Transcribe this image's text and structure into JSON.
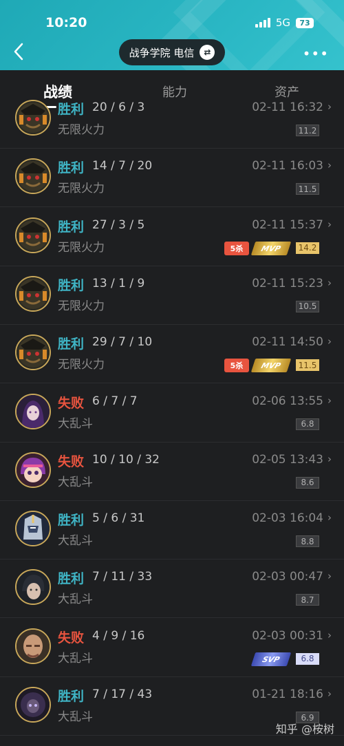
{
  "status_bar": {
    "time": "10:20",
    "network": "5G",
    "battery": "73"
  },
  "header": {
    "server": "战争学院 电信",
    "back_icon": "chevron-left-icon",
    "more_icon": "more-dots-icon",
    "swap_icon": "swap-icon"
  },
  "tabs": [
    {
      "label": "战绩",
      "active": true
    },
    {
      "label": "能力",
      "active": false
    },
    {
      "label": "资产",
      "active": false
    }
  ],
  "matches": [
    {
      "result": "胜利",
      "outcome": "win",
      "kda": "20 / 6 / 3",
      "mode": "无限火力",
      "datetime": "02-11 16:32",
      "score": "11.2",
      "score_style": "gray",
      "champion": "twisted-fate",
      "badges": []
    },
    {
      "result": "胜利",
      "outcome": "win",
      "kda": "14 / 7 / 20",
      "mode": "无限火力",
      "datetime": "02-11 16:03",
      "score": "11.5",
      "score_style": "gray",
      "champion": "twisted-fate",
      "badges": []
    },
    {
      "result": "胜利",
      "outcome": "win",
      "kda": "27 / 3 / 5",
      "mode": "无限火力",
      "datetime": "02-11 15:37",
      "score": "14.2",
      "score_style": "gold",
      "champion": "twisted-fate",
      "badges": [
        "5杀",
        "MVP"
      ]
    },
    {
      "result": "胜利",
      "outcome": "win",
      "kda": "13 / 1 / 9",
      "mode": "无限火力",
      "datetime": "02-11 15:23",
      "score": "10.5",
      "score_style": "gray",
      "champion": "twisted-fate",
      "badges": []
    },
    {
      "result": "胜利",
      "outcome": "win",
      "kda": "29 / 7 / 10",
      "mode": "无限火力",
      "datetime": "02-11 14:50",
      "score": "11.5",
      "score_style": "gold",
      "champion": "twisted-fate",
      "badges": [
        "5杀",
        "MVP"
      ]
    },
    {
      "result": "失败",
      "outcome": "lose",
      "kda": "6 / 7 / 7",
      "mode": "大乱斗",
      "datetime": "02-06 13:55",
      "score": "6.8",
      "score_style": "gray",
      "champion": "purple-mage",
      "badges": []
    },
    {
      "result": "失败",
      "outcome": "lose",
      "kda": "10 / 10 / 32",
      "mode": "大乱斗",
      "datetime": "02-05 13:43",
      "score": "8.6",
      "score_style": "gray",
      "champion": "pink-girl",
      "badges": []
    },
    {
      "result": "胜利",
      "outcome": "win",
      "kda": "5 / 6 / 31",
      "mode": "大乱斗",
      "datetime": "02-03 16:04",
      "score": "8.8",
      "score_style": "gray",
      "champion": "armored-knight",
      "badges": []
    },
    {
      "result": "胜利",
      "outcome": "win",
      "kda": "7 / 11 / 33",
      "mode": "大乱斗",
      "datetime": "02-03 00:47",
      "score": "8.7",
      "score_style": "gray",
      "champion": "dark-swordsman",
      "badges": []
    },
    {
      "result": "失败",
      "outcome": "lose",
      "kda": "4 / 9 / 16",
      "mode": "大乱斗",
      "datetime": "02-03 00:31",
      "score": "6.8",
      "score_style": "purple",
      "champion": "bald-warrior",
      "badges": [
        "SVP"
      ]
    },
    {
      "result": "胜利",
      "outcome": "win",
      "kda": "7 / 17 / 43",
      "mode": "大乱斗",
      "datetime": "01-21 18:16",
      "score": "6.9",
      "score_style": "gray",
      "champion": "shadow-mage",
      "badges": []
    }
  ],
  "watermark": "知乎 @桉树",
  "colors": {
    "header": "#2ab7c4",
    "win": "#3fb4c5",
    "lose": "#e8543f",
    "background": "#1e1f21"
  }
}
